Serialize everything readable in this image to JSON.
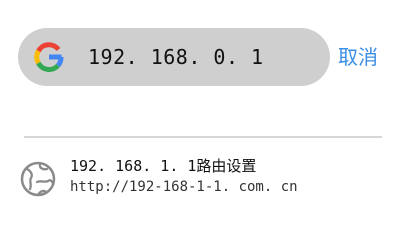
{
  "search": {
    "engine_icon": "google-g-icon",
    "query": "192. 168. 0. 1"
  },
  "header": {
    "cancel_label": "取消"
  },
  "suggestions": [
    {
      "icon": "globe-icon",
      "title": "192. 168. 1. 1路由设置",
      "url": "http://192-168-1-1. com. cn"
    }
  ],
  "colors": {
    "search_bg": "#cfcfcf",
    "accent": "#3a8ee6",
    "divider": "#d6d6d6",
    "icon_gray": "#8a8a8a"
  }
}
